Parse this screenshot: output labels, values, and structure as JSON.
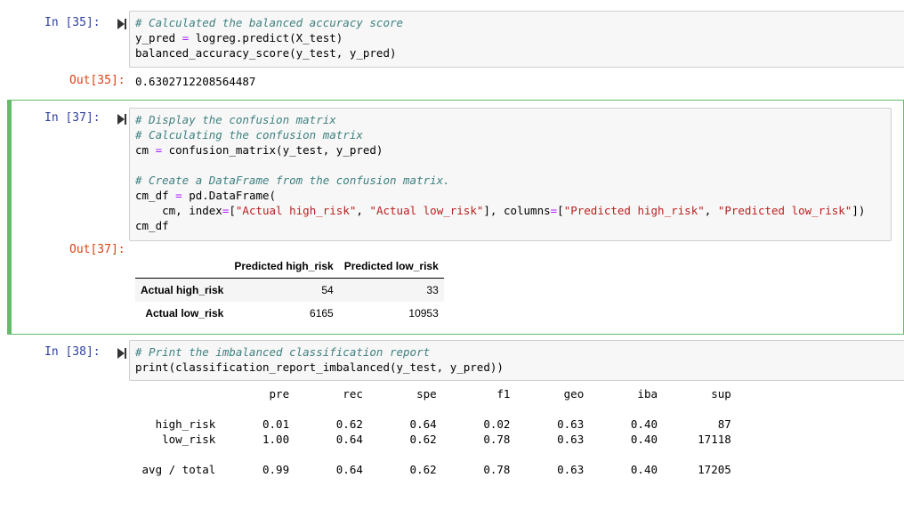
{
  "cells": [
    {
      "in_prompt": "In [35]:",
      "code_lines": [
        [
          {
            "t": "# Calculated the balanced accuracy score",
            "c": "cm"
          }
        ],
        [
          {
            "t": "y_pred "
          },
          {
            "t": "=",
            "c": "op"
          },
          {
            "t": " logreg.predict(X_test)"
          }
        ],
        [
          {
            "t": "balanced_accuracy_score(y_test, y_pred)"
          }
        ]
      ],
      "out_prompt": "Out[35]:",
      "output": "0.6302712208564487"
    },
    {
      "in_prompt": "In [37]:",
      "code_lines": [
        [
          {
            "t": "# Display the confusion matrix",
            "c": "cm"
          }
        ],
        [
          {
            "t": "# Calculating the confusion matrix",
            "c": "cm"
          }
        ],
        [
          {
            "t": "cm "
          },
          {
            "t": "=",
            "c": "op"
          },
          {
            "t": " confusion_matrix(y_test, y_pred)"
          }
        ],
        [
          {
            "t": ""
          }
        ],
        [
          {
            "t": "# Create a DataFrame from the confusion matrix.",
            "c": "cm"
          }
        ],
        [
          {
            "t": "cm_df "
          },
          {
            "t": "=",
            "c": "op"
          },
          {
            "t": " pd.DataFrame("
          }
        ],
        [
          {
            "t": "    cm, index"
          },
          {
            "t": "=",
            "c": "op"
          },
          {
            "t": "["
          },
          {
            "t": "\"Actual high_risk\"",
            "c": "st"
          },
          {
            "t": ", "
          },
          {
            "t": "\"Actual low_risk\"",
            "c": "st"
          },
          {
            "t": "], columns"
          },
          {
            "t": "=",
            "c": "op"
          },
          {
            "t": "["
          },
          {
            "t": "\"Predicted high_risk\"",
            "c": "st"
          },
          {
            "t": ", "
          },
          {
            "t": "\"Predicted low_risk\"",
            "c": "st"
          },
          {
            "t": "])"
          }
        ],
        [
          {
            "t": "cm_df"
          }
        ]
      ],
      "out_prompt": "Out[37]:",
      "dataframe": {
        "columns": [
          "Predicted high_risk",
          "Predicted low_risk"
        ],
        "rows": [
          {
            "index": "Actual high_risk",
            "values": [
              "54",
              "33"
            ]
          },
          {
            "index": "Actual low_risk",
            "values": [
              "6165",
              "10953"
            ]
          }
        ]
      }
    },
    {
      "in_prompt": "In [38]:",
      "code_lines": [
        [
          {
            "t": "# Print the imbalanced classification report",
            "c": "cm"
          }
        ],
        [
          {
            "t": "print(classification_report_imbalanced(y_test, y_pred))"
          }
        ]
      ],
      "report": {
        "header": [
          "pre",
          "rec",
          "spe",
          "f1",
          "geo",
          "iba",
          "sup"
        ],
        "rows": [
          {
            "label": "high_risk",
            "values": [
              "0.01",
              "0.62",
              "0.64",
              "0.02",
              "0.63",
              "0.40",
              "87"
            ]
          },
          {
            "label": "low_risk",
            "values": [
              "1.00",
              "0.64",
              "0.62",
              "0.78",
              "0.63",
              "0.40",
              "17118"
            ]
          }
        ],
        "total": {
          "label": "avg / total",
          "values": [
            "0.99",
            "0.64",
            "0.62",
            "0.78",
            "0.63",
            "0.40",
            "17205"
          ]
        }
      }
    }
  ],
  "icons": {
    "run": "run-cell-icon"
  },
  "colors": {
    "selected_border": "#66bb6a",
    "in_prompt": "#303f9f",
    "out_prompt": "#d84315"
  }
}
